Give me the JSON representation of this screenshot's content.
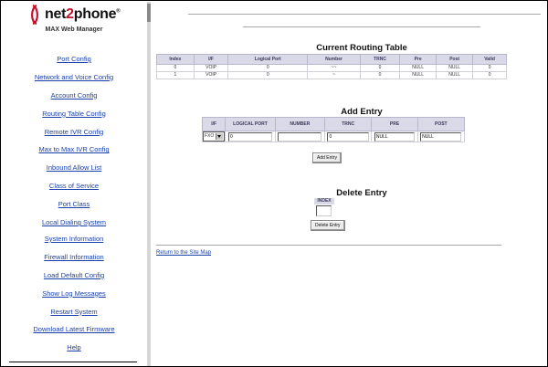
{
  "brand": {
    "name_a": "net",
    "name_b": "2",
    "name_c": "phone",
    "reg": "®",
    "subtitle": "MAX Web Manager",
    "accent": "#c8102e"
  },
  "nav_primary": [
    "Port Config",
    "Network and Voice Config",
    "Account Config",
    "Routing Table Config",
    "Remote IVR Config",
    "Max to Max IVR Config",
    "Inbound Allow List",
    "Class of Service",
    "Port Class",
    "Local Dialing System"
  ],
  "nav_secondary": [
    "System Information",
    "Firewall Information",
    "Load Default Config",
    "Show Log Messages",
    "Restart System",
    "Download Latest Firmware",
    "Help"
  ],
  "routing": {
    "title": "Current Routing Table",
    "headers": [
      "Index",
      "I/F",
      "Logical Port",
      "Number",
      "TRNC",
      "Pre",
      "Post",
      "Valid"
    ],
    "rows": [
      [
        "0",
        "VOIP",
        "0",
        "~~",
        "0",
        "NULL",
        "NULL",
        "0"
      ],
      [
        "1",
        "VOIP",
        "0",
        "~",
        "0",
        "NULL",
        "NULL",
        "0"
      ]
    ]
  },
  "add_entry": {
    "title": "Add Entry",
    "headers": [
      "I/F",
      "LOGICAL PORT",
      "NUMBER",
      "TRNC",
      "PRE",
      "POST"
    ],
    "if_selected": "FXO",
    "logical_port": "0",
    "number": "",
    "trnc": "0",
    "pre": "NULL",
    "post": "NULL",
    "button": "Add Entry"
  },
  "delete_entry": {
    "title": "Delete Entry",
    "index_label": "INDEX",
    "index_value": "",
    "button": "Delete Entry"
  },
  "footer_link": "Return to the Site Map"
}
